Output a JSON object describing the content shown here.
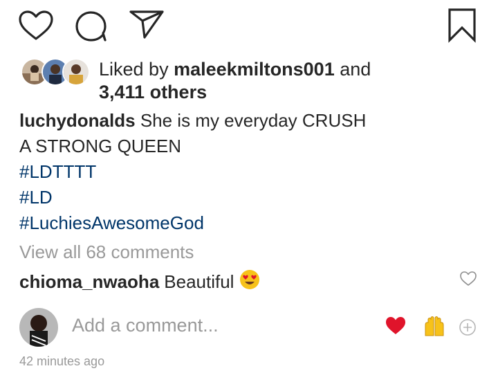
{
  "actions": {
    "like_icon": "heart-outline-icon",
    "comment_icon": "speech-bubble-icon",
    "share_icon": "paper-plane-icon",
    "save_icon": "bookmark-icon"
  },
  "likes": {
    "prefix": "Liked by",
    "first_user": "maleekmiltons001",
    "conjunction": "and",
    "others": "3,411 others"
  },
  "caption": {
    "username": "luchydonalds",
    "line1": "She is my everyday CRUSH",
    "line2": "A STRONG QUEEN",
    "hashtags": [
      "#LDTTTT",
      "#LD",
      "#LuchiesAwesomeGod"
    ]
  },
  "view_all": "View all 68 comments",
  "comment": {
    "username": "chioma_nwaoha",
    "text": "Beautiful",
    "emoji": "heart-eyes-emoji"
  },
  "add_comment": {
    "placeholder": "Add a comment...",
    "quick_reactions": [
      "red-heart-emoji",
      "raised-hands-emoji"
    ]
  },
  "timestamp": "42 minutes ago",
  "colors": {
    "text": "#262626",
    "muted": "#999999",
    "hashtag": "#003569",
    "heart_red": "#e0142b",
    "emoji_yellow": "#f7c21a"
  }
}
